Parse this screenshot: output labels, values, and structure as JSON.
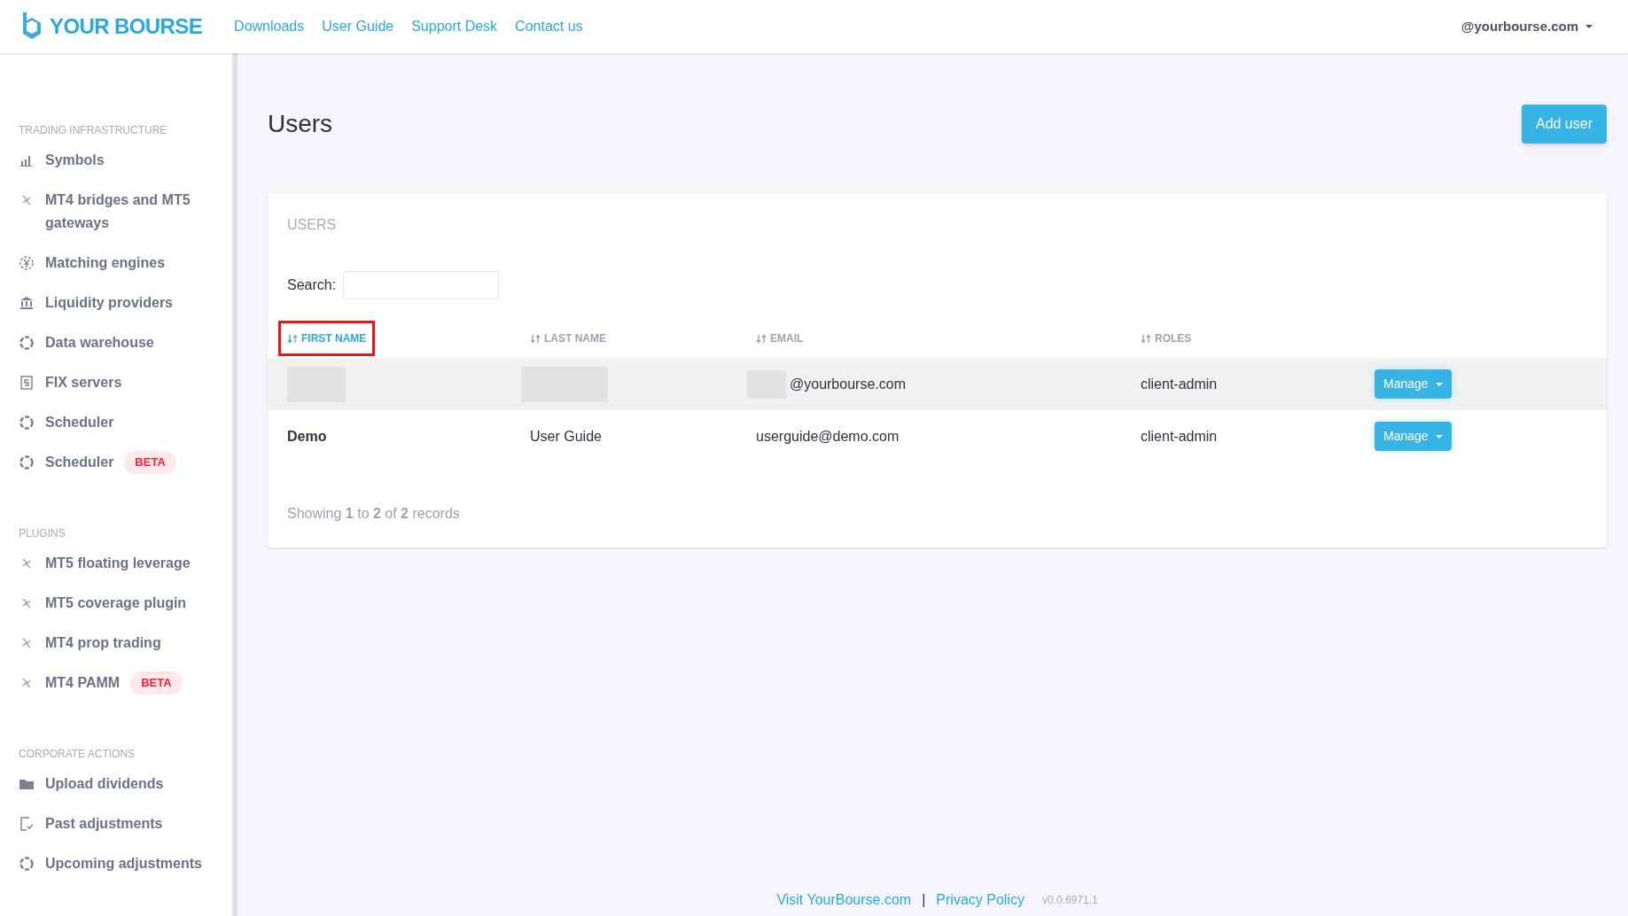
{
  "header": {
    "logo": "YOUR BOURSE",
    "nav": [
      "Downloads",
      "User Guide",
      "Support Desk",
      "Contact us"
    ],
    "account": "@yourbourse.com"
  },
  "sidebar": {
    "sections": [
      {
        "title": "TRADING INFRASTRUCTURE",
        "items": [
          {
            "label": "Symbols"
          },
          {
            "label": "MT4 bridges and MT5 gateways"
          },
          {
            "label": "Matching engines"
          },
          {
            "label": "Liquidity providers"
          },
          {
            "label": "Data warehouse"
          },
          {
            "label": "FIX servers"
          },
          {
            "label": "Scheduler"
          },
          {
            "label": "Scheduler",
            "badge": "BETA"
          }
        ]
      },
      {
        "title": "PLUGINS",
        "items": [
          {
            "label": "MT5 floating leverage"
          },
          {
            "label": "MT5 coverage plugin"
          },
          {
            "label": "MT4 prop trading"
          },
          {
            "label": "MT4 PAMM",
            "badge": "BETA"
          }
        ]
      },
      {
        "title": "CORPORATE ACTIONS",
        "items": [
          {
            "label": "Upload dividends"
          },
          {
            "label": "Past adjustments"
          },
          {
            "label": "Upcoming adjustments"
          }
        ]
      }
    ]
  },
  "page": {
    "title": "Users",
    "add_button": "Add user"
  },
  "card": {
    "title": "USERS",
    "search_label": "Search:",
    "columns": [
      {
        "label": "FIRST NAME",
        "sorted": true,
        "annotated": true
      },
      {
        "label": "LAST NAME",
        "sorted": false,
        "annotated": false
      },
      {
        "label": "EMAIL",
        "sorted": false,
        "annotated": false
      },
      {
        "label": "ROLES",
        "sorted": false,
        "annotated": false
      }
    ],
    "rows": [
      {
        "first_name": "",
        "last_name": "",
        "email": "@yourbourse.com",
        "roles": "client-admin",
        "action": "Manage",
        "redacted": true,
        "selected": true
      },
      {
        "first_name": "Demo",
        "last_name": "User Guide",
        "email": "userguide@demo.com",
        "roles": "client-admin",
        "action": "Manage",
        "redacted": false,
        "selected": false
      }
    ],
    "info": "Showing **1** to **2** of **2** records"
  },
  "footer": {
    "links": [
      "Visit YourBourse.com",
      "Privacy Policy"
    ],
    "separator": "|",
    "version": "v0.0.6971.1"
  }
}
